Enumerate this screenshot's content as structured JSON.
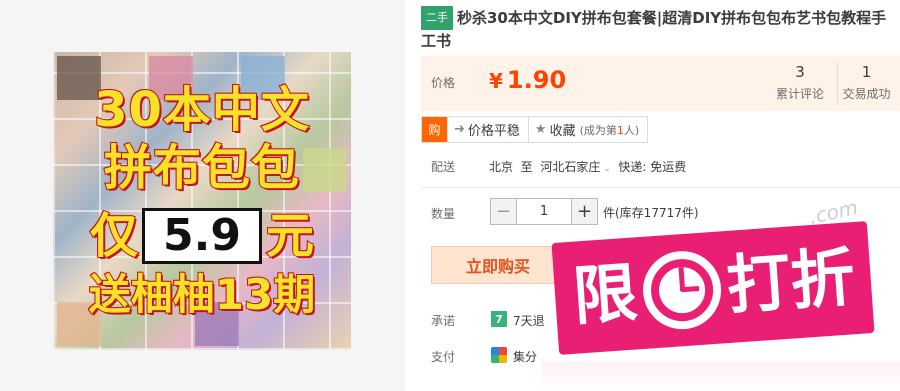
{
  "gallery": {
    "poster": {
      "line1": "30本中文",
      "line2": "拼布包包",
      "line3_prefix": "仅",
      "line3_price": "5.9",
      "line3_suffix": "元",
      "line4": "送柚柚13期"
    }
  },
  "product": {
    "tag": "二手",
    "title": "秒杀30本中文DIY拼布包套餐|超清DIY拼布包包布艺书包教程手工书"
  },
  "price_panel": {
    "label": "价格",
    "currency": "¥",
    "amount": "1.90",
    "reviews_count": "3",
    "reviews_label": "累计评论",
    "deals_count": "1",
    "deals_label": "交易成功"
  },
  "actions": {
    "buy_icon_label": "购",
    "compare_label": "价格平稳",
    "favorite_label": "收藏",
    "favorite_note_prefix": "(成为第",
    "favorite_note_num": "1",
    "favorite_note_suffix": "人)"
  },
  "shipping": {
    "label": "配送",
    "from": "北京",
    "to_word": "至",
    "destination": "河北石家庄",
    "method": "快递: 免运费"
  },
  "quantity": {
    "label": "数量",
    "value": "1",
    "minus": "−",
    "plus": "+",
    "stock": "件(库存17717件)"
  },
  "buy": {
    "label": "立即购买"
  },
  "promise": {
    "label": "承诺",
    "icon_text": "7",
    "text": "7天退"
  },
  "payment": {
    "label": "支付",
    "text": "集分"
  },
  "promo": {
    "watermark": ".com",
    "char1": "限",
    "char2": "打折"
  },
  "colors": {
    "price": "#ff4400",
    "used_tag": "#2ea36a",
    "promo": "#e91f74",
    "buy_bg": "#ffe4d0"
  }
}
